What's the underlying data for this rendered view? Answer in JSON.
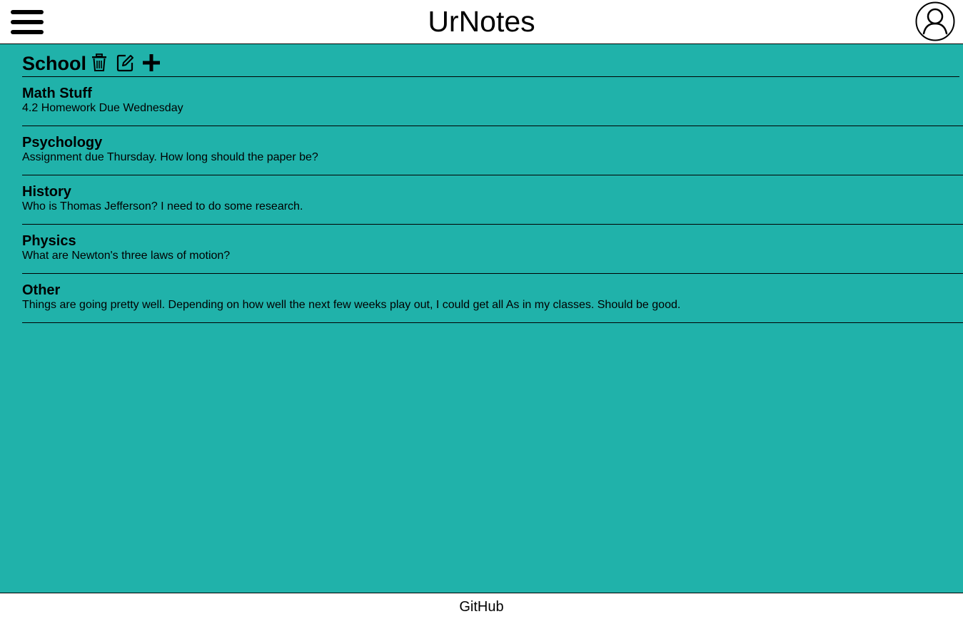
{
  "app": {
    "title": "UrNotes"
  },
  "header": {
    "menu_icon": "hamburger-menu-icon",
    "account_icon": "user-account-icon"
  },
  "notebook": {
    "title": "School",
    "actions": [
      {
        "name": "delete",
        "icon": "trash-icon"
      },
      {
        "name": "edit",
        "icon": "edit-icon"
      },
      {
        "name": "add",
        "icon": "plus-icon"
      }
    ]
  },
  "notes": [
    {
      "title": "Math Stuff",
      "body": "4.2 Homework Due Wednesday"
    },
    {
      "title": "Psychology",
      "body": "Assignment due Thursday. How long should the paper be?"
    },
    {
      "title": "History",
      "body": "Who is Thomas Jefferson? I need to do some research."
    },
    {
      "title": "Physics",
      "body": "What are Newton's three laws of motion?"
    },
    {
      "title": "Other",
      "body": "Things are going pretty well. Depending on how well the next few weeks play out, I could get all As in my classes. Should be good."
    }
  ],
  "footer": {
    "link_label": "GitHub"
  },
  "colors": {
    "background": "#20b2aa",
    "header": "#ffffff",
    "text": "#000000"
  }
}
